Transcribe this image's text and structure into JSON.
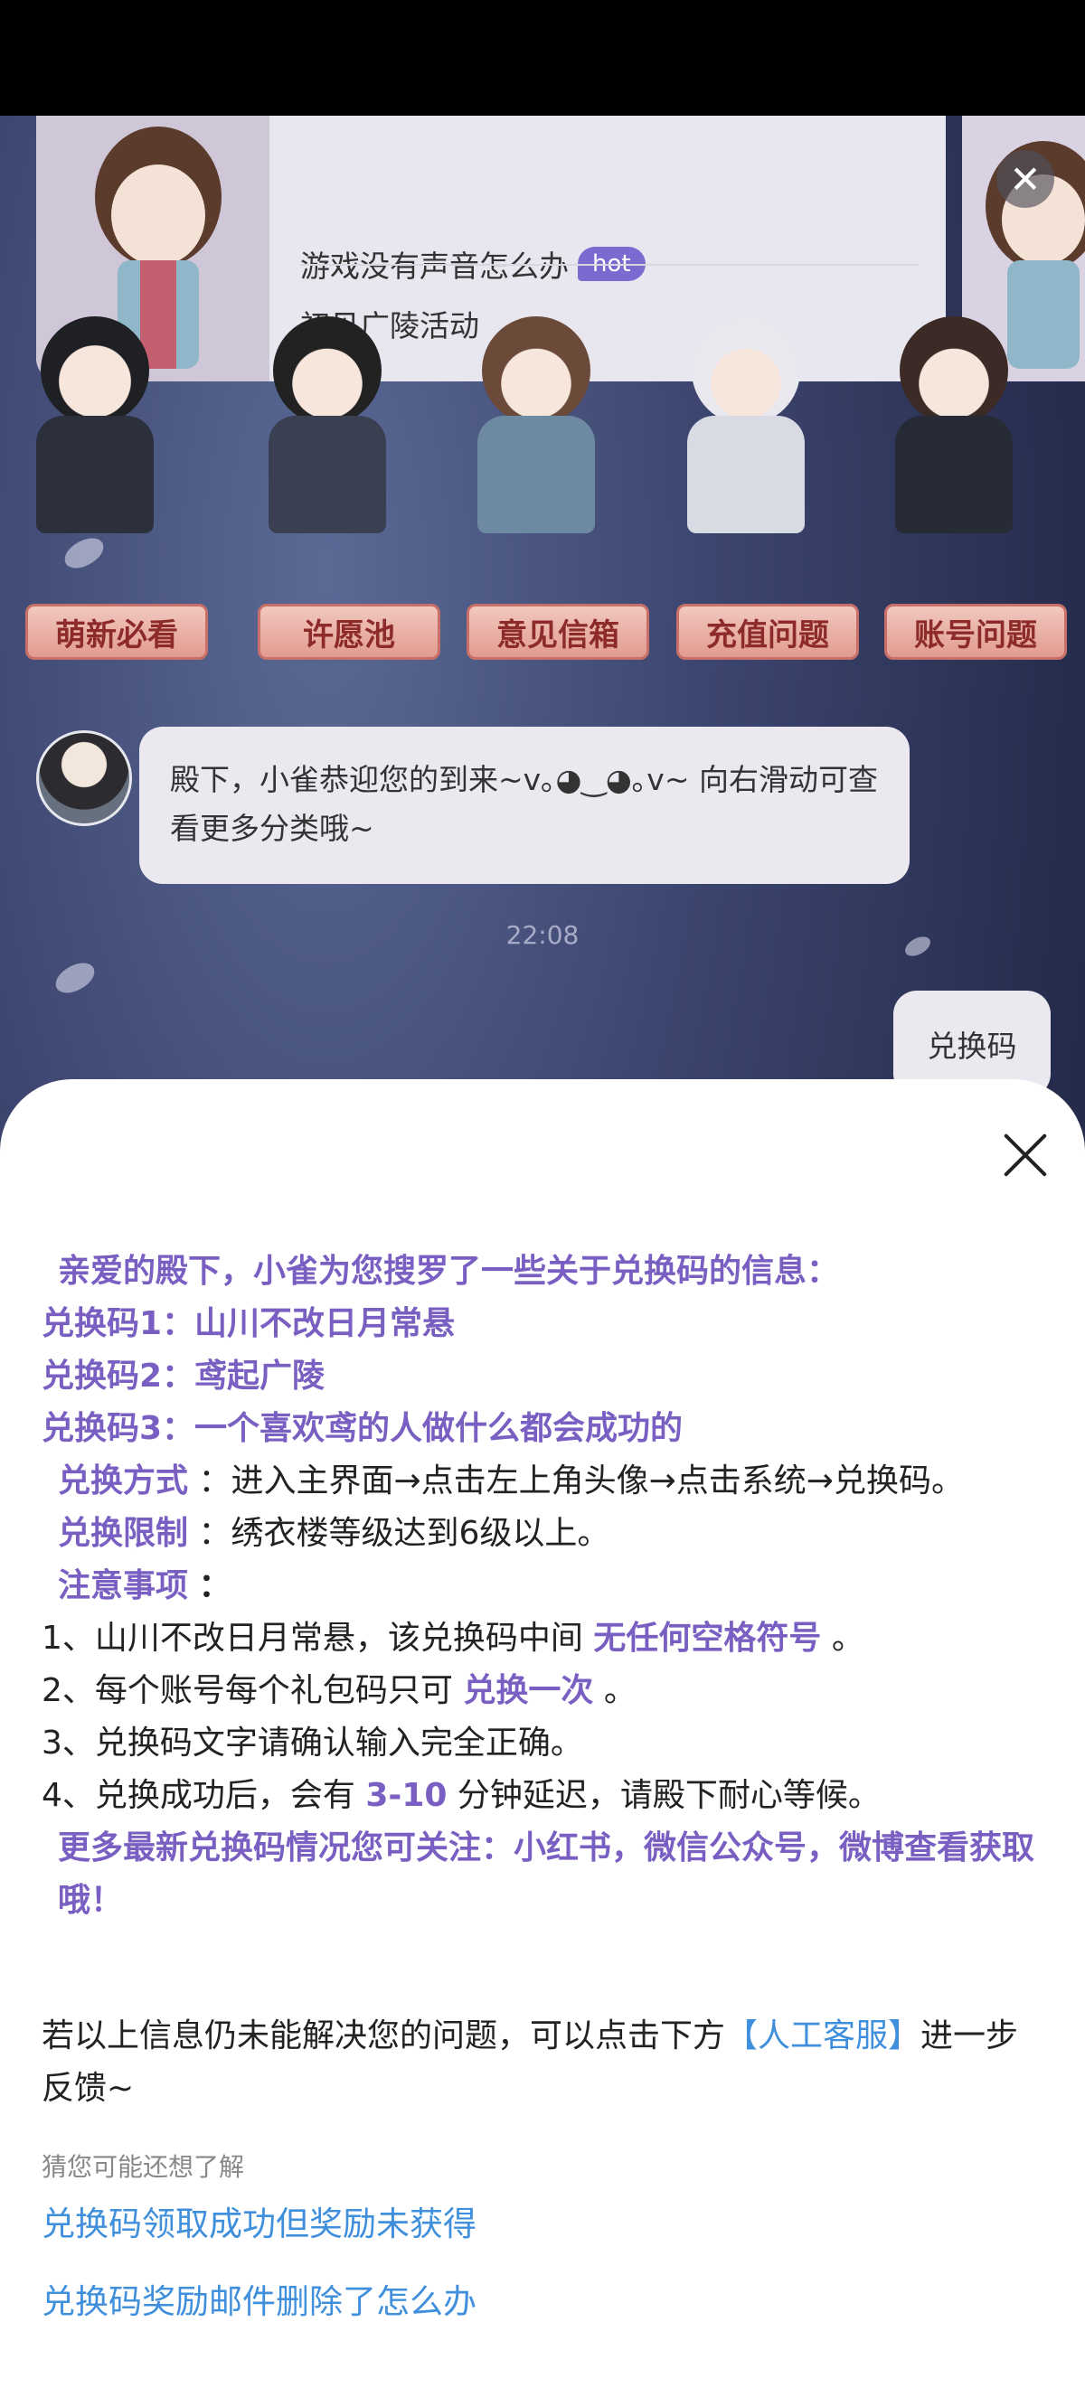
{
  "menu": {
    "items": [
      "游戏没有声音怎么办",
      "初见广陵活动"
    ],
    "hot_badge": "hot"
  },
  "close_icon_glyph": "✕",
  "categories": [
    {
      "label": "萌新必看",
      "icon": "newbie-character-icon"
    },
    {
      "label": "许愿池",
      "icon": "wish-pool-character-icon"
    },
    {
      "label": "意见信箱",
      "icon": "feedback-mailbox-character-icon"
    },
    {
      "label": "充值问题",
      "icon": "recharge-character-icon"
    },
    {
      "label": "账号问题",
      "icon": "account-character-icon"
    }
  ],
  "chat": {
    "bot_message": "殿下，小雀恭迎您的到来~v｡◕‿◕｡v~ 向右滑动可查看更多分类哦~",
    "timestamp": "22:08",
    "user_message": "兑换码"
  },
  "sheet": {
    "intro": "亲爱的殿下，小雀为您搜罗了一些关于兑换码的信息：",
    "codes": [
      "兑换码1：山川不改日月常悬",
      "兑换码2：鸢起广陵",
      "兑换码3：一个喜欢鸢的人做什么都会成功的"
    ],
    "method_label": "兑换方式",
    "method_text": "：进入主界面→点击左上角头像→点击系统→兑换码。",
    "limit_label": "兑换限制",
    "limit_text": "：绣衣楼等级达到6级以上。",
    "notes_label": "注意事项",
    "notes_colon": "：",
    "note1_a": "1、山川不改日月常悬，该兑换码中间",
    "note1_b": "无任何空格符号",
    "note1_c": "。",
    "note2_a": "2、每个账号每个礼包码只可",
    "note2_b": "兑换一次",
    "note2_c": "。",
    "note3": "3、兑换码文字请确认输入完全正确。",
    "note4_a": "4、兑换成功后，会有",
    "note4_b": "3-10",
    "note4_c": "分钟延迟，请殿下耐心等候。",
    "follow": "更多最新兑换码情况您可关注：小红书，微信公众号，微博查看获取哦！",
    "feedback_a": "若以上信息仍未能解决您的问题，可以点击下方",
    "feedback_link": "【人工客服】",
    "feedback_b": "进一步反馈~",
    "hint": "猜您可能还想了解",
    "related": [
      "兑换码领取成功但奖励未获得",
      "兑换码奖励邮件删除了怎么办"
    ]
  },
  "colors": {
    "accent_purple": "#7a5fc2",
    "link_blue": "#3f8fdc"
  }
}
